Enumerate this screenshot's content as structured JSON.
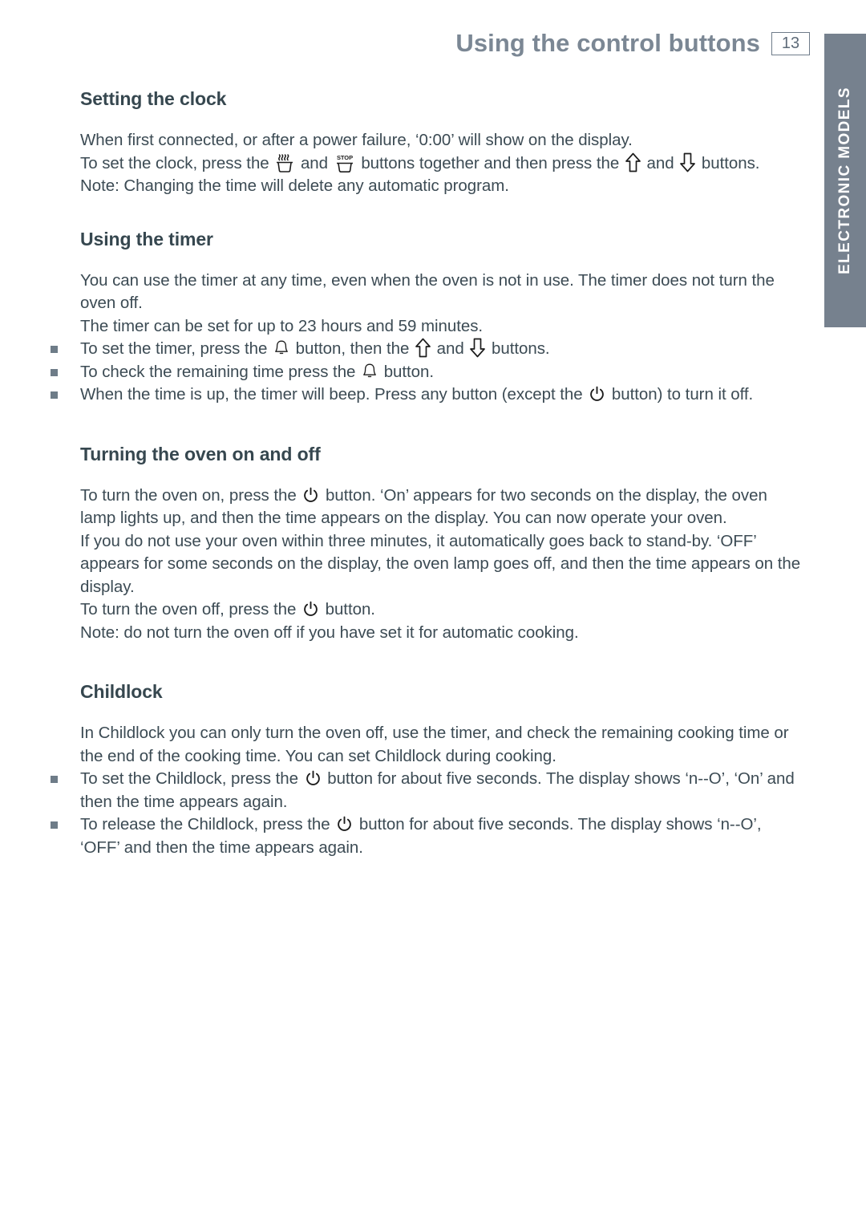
{
  "header": {
    "title": "Using the control buttons",
    "page_number": "13"
  },
  "side_tab": {
    "label": "ELECTRONIC MODELS",
    "background_color": "#76818e",
    "text_color": "#ffffff"
  },
  "colors": {
    "heading": "#36474f",
    "body": "#3c4b54",
    "header_title": "#7b8794",
    "bullet": "#6e7c88"
  },
  "sections": [
    {
      "heading": "Setting the clock",
      "paragraphs": [
        "When first connected, or after a power failure, '0:00' will show on the display.",
        "To set the clock, press the [cook-icon] and [stop-icon] buttons together and then press the [arrow-up-icon] and [arrow-down-icon] buttons.",
        "Note: Changing the time will delete any automatic program."
      ],
      "lines": {
        "l1": "When first connected, or after a power failure, ‘0:00’ will show on the display.",
        "l2a": "To set the clock, press the ",
        "l2b": " and ",
        "l2c": " buttons together and then press the ",
        "l2d": " and ",
        "l2e": " buttons.",
        "l3": "Note: Changing the time will delete any automatic program."
      }
    },
    {
      "heading": "Using the timer",
      "lines": {
        "p1": "You can use the timer at any time, even when the oven is not in use. The timer does not turn the oven off.",
        "p2": "The timer can be set for up to 23 hours and 59 minutes.",
        "b1a": "To set the timer, press the ",
        "b1b": " button, then the ",
        "b1c": " and ",
        "b1d": " buttons.",
        "b2a": "To check the remaining time press the ",
        "b2b": " button.",
        "b3a": "When the time is up, the timer will beep.  Press any button (except the ",
        "b3b": " button) to turn it off."
      }
    },
    {
      "heading": "Turning the oven on and off",
      "lines": {
        "p1a": "To turn the oven on, press the ",
        "p1b": " button. ‘On’ appears for two seconds on the display, the oven lamp lights up, and then the time appears on the display. You can now operate your oven.",
        "p2": "If you do not use your oven within three minutes, it automatically goes back to stand-by. ‘OFF’ appears for some seconds on the display, the oven lamp goes off, and then the time appears on the display.",
        "p3a": "To turn the oven off, press the ",
        "p3b": " button.",
        "p4": "Note: do not turn the oven off if you have set it for automatic cooking."
      }
    },
    {
      "heading": "Childlock",
      "lines": {
        "p1": "In Childlock you can only turn the oven off, use the timer, and check the remaining cooking time or the end of the cooking time. You can set Childlock during cooking.",
        "b1a": "To set the Childlock, press the ",
        "b1b": " button for about five seconds. The display shows ‘n--O’, ‘On’ and then the time appears again.",
        "b2a": "To release the Childlock, press the ",
        "b2b": " button for about five seconds. The display shows ‘n--O’, ‘OFF’ and then the time appears again."
      }
    }
  ],
  "icons": {
    "cook": "cook-pot-icon",
    "stop": "stop-pot-icon",
    "arrow_up": "arrow-up-icon",
    "arrow_down": "arrow-down-icon",
    "bell": "timer-bell-icon",
    "power": "power-icon",
    "stop_label": "STOP"
  }
}
